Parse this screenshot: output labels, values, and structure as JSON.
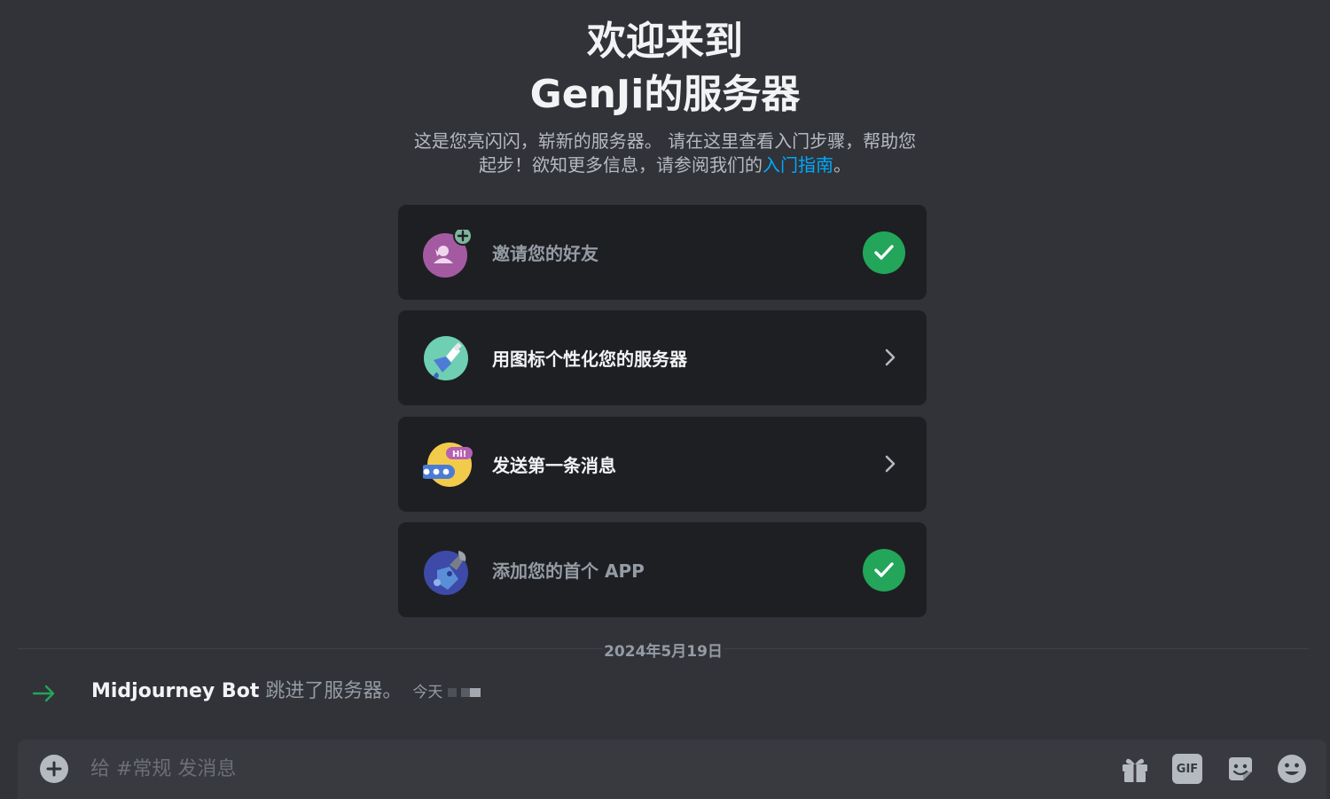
{
  "welcome": {
    "title_line1": "欢迎来到",
    "title_line2": "GenJi的服务器",
    "subtitle_line1": "这是您亮闪闪，崭新的服务器。 请在这里查看入门步骤，帮助您",
    "subtitle_line2_prefix": "起步！欲知更多信息，请参阅我们的",
    "subtitle_link": "入门指南",
    "subtitle_line2_suffix": "。"
  },
  "checklist": [
    {
      "label": "邀请您的好友",
      "status": "done",
      "icon": "invite-friends-icon"
    },
    {
      "label": "用图标个性化您的服务器",
      "status": "todo",
      "icon": "paint-brush-icon"
    },
    {
      "label": "发送第一条消息",
      "status": "todo",
      "icon": "chat-bubble-icon"
    },
    {
      "label": "添加您的首个 APP",
      "status": "done",
      "icon": "app-wrench-icon"
    }
  ],
  "messages": {
    "date_divider": "2024年5月19日",
    "join": {
      "username": "Midjourney Bot",
      "action": " 跳进了服务器。",
      "timestamp_prefix": "今天"
    }
  },
  "composer": {
    "placeholder": "给 #常规 发消息",
    "gif_label": "GIF"
  },
  "colors": {
    "background": "#313338",
    "card": "#1e1f22",
    "check_green": "#23a55a",
    "link": "#00a8fc"
  }
}
